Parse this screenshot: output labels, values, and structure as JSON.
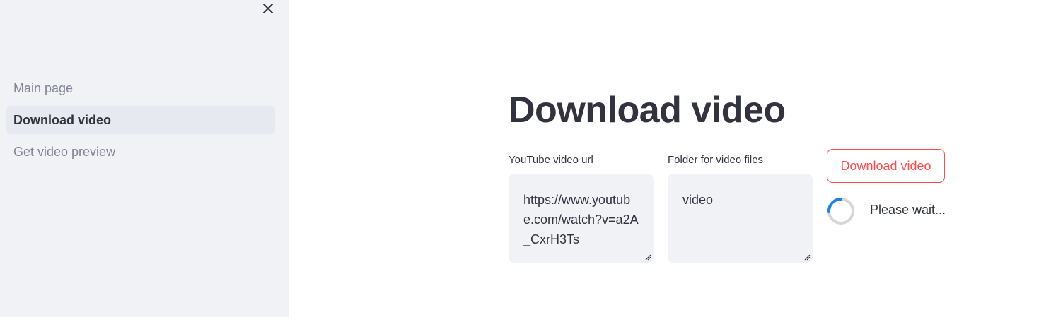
{
  "sidebar": {
    "close_icon": "close-icon",
    "nav_items": [
      {
        "label": "Main page",
        "active": false
      },
      {
        "label": "Download video",
        "active": true
      },
      {
        "label": "Get video preview",
        "active": false
      }
    ]
  },
  "main": {
    "title": "Download video",
    "url_field": {
      "label": "YouTube video url",
      "value": "https://www.youtube.com/watch?v=a2A_CxrH3Ts"
    },
    "folder_field": {
      "label": "Folder for video files",
      "value": "video"
    },
    "download_button": {
      "label": "Download video"
    },
    "status": {
      "spinner_icon": "spinner-icon",
      "text": "Please wait..."
    }
  },
  "colors": {
    "accent": "#ff4b4b",
    "sidebar_bg": "#f0f2f6",
    "spinner": "#1c83e1",
    "text": "#31333f",
    "muted_text": "#808495"
  }
}
